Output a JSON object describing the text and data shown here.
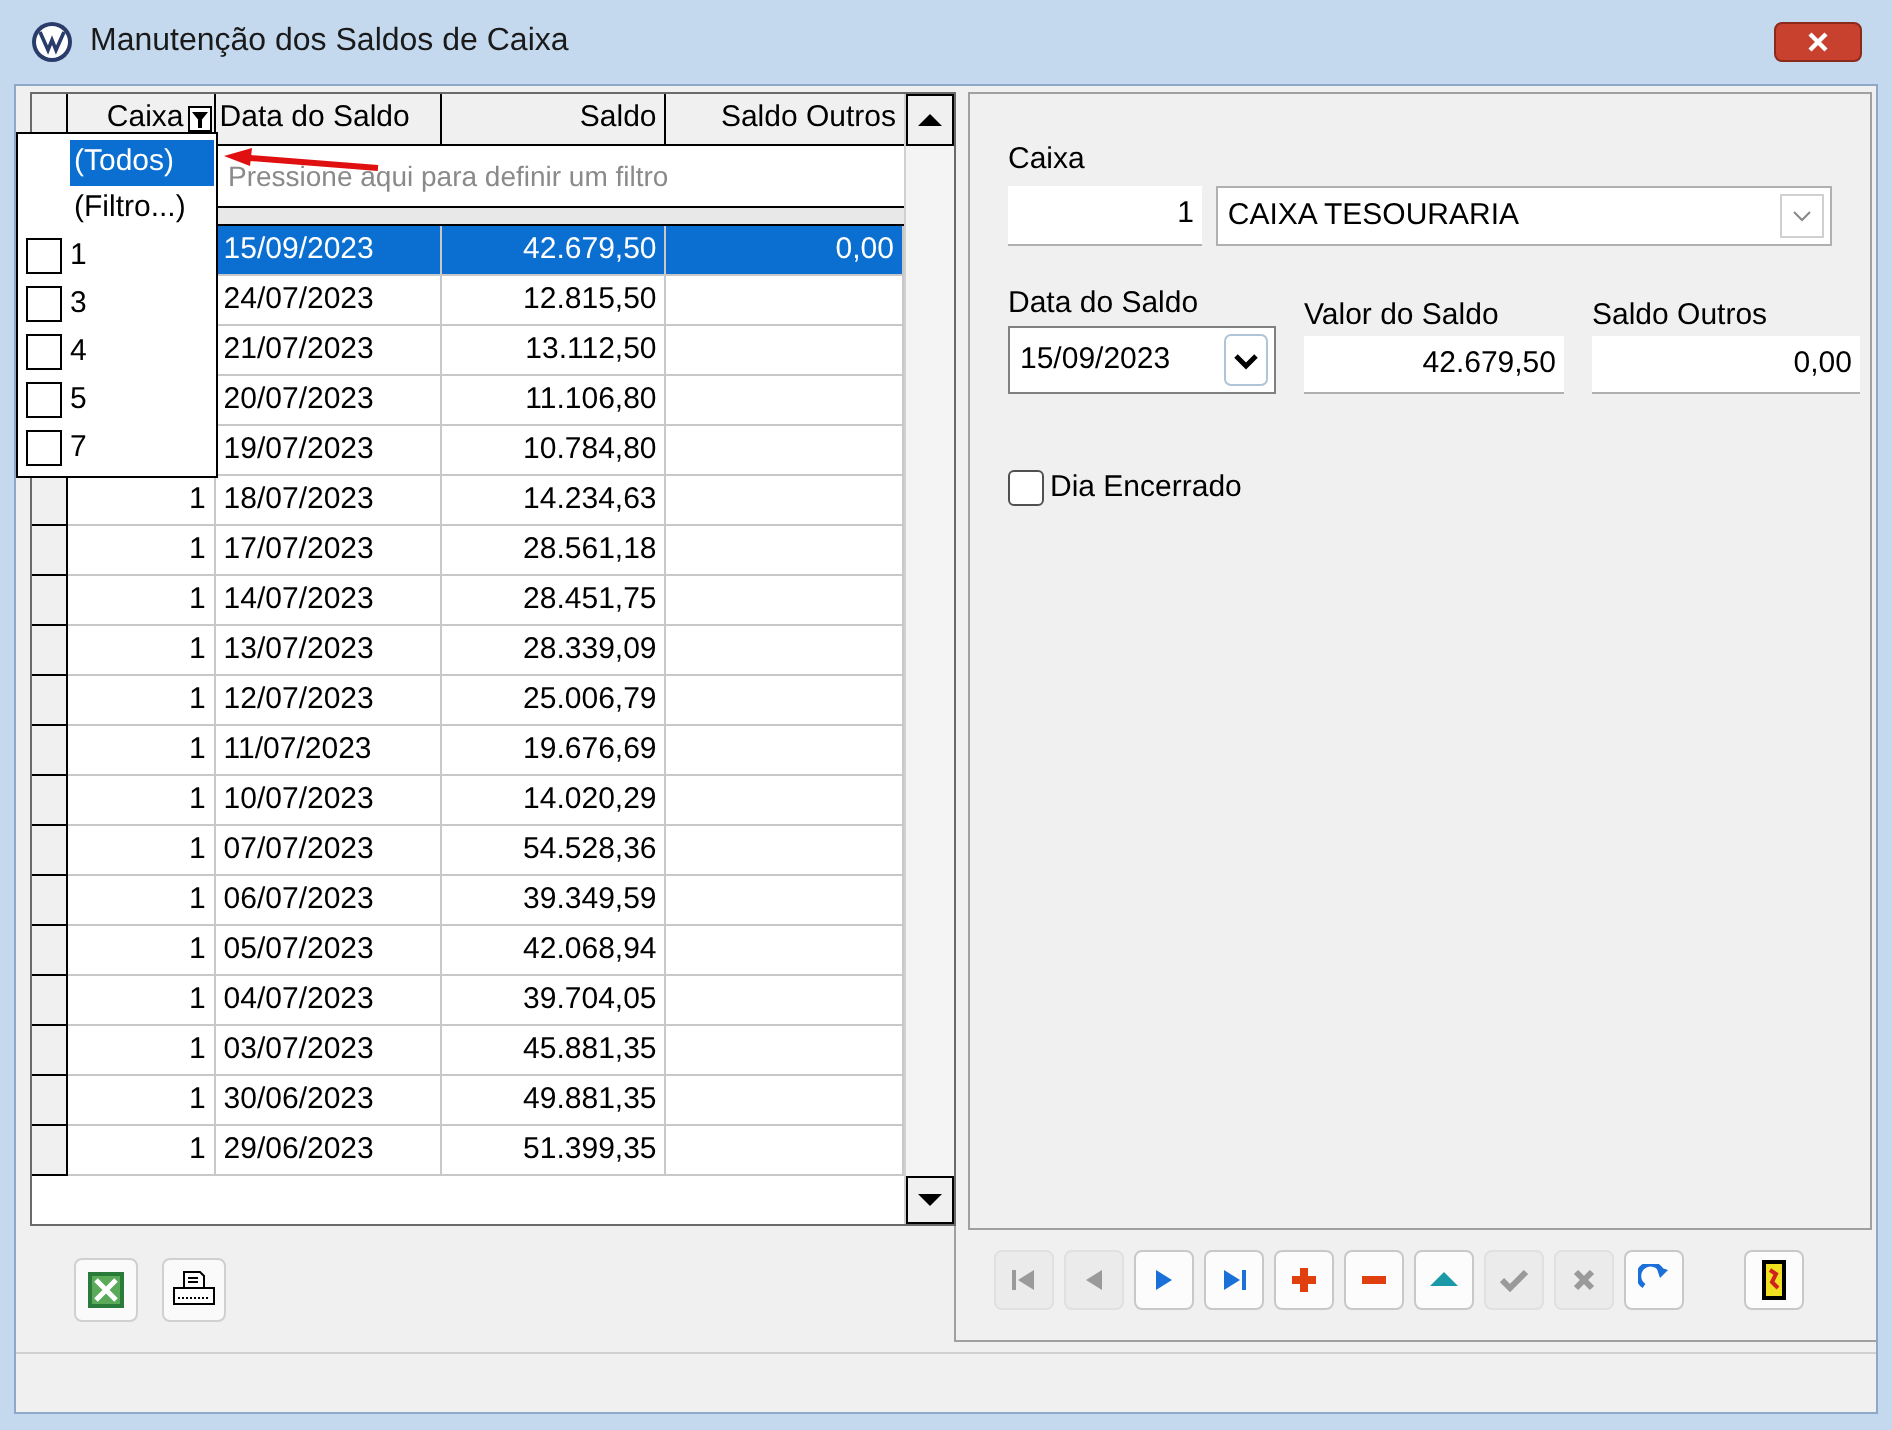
{
  "window": {
    "title": "Manutenção dos Saldos de Caixa"
  },
  "table": {
    "columns": [
      "Caixa",
      "Data do Saldo",
      "Saldo",
      "Saldo Outros"
    ],
    "filter_hint": "Pressione aqui para definir um filtro",
    "rows": [
      {
        "data": "15/09/2023",
        "saldo": "42.679,50",
        "outros": "0,00",
        "selected": true
      },
      {
        "data": "24/07/2023",
        "saldo": "12.815,50",
        "selected": false
      },
      {
        "data": "21/07/2023",
        "saldo": "13.112,50",
        "selected": false
      },
      {
        "data": "20/07/2023",
        "saldo": "11.106,80",
        "selected": false
      },
      {
        "data": "19/07/2023",
        "saldo": "10.784,80",
        "selected": false
      },
      {
        "caixa": "1",
        "data": "18/07/2023",
        "saldo": "14.234,63",
        "selected": false
      },
      {
        "caixa": "1",
        "data": "17/07/2023",
        "saldo": "28.561,18",
        "selected": false
      },
      {
        "caixa": "1",
        "data": "14/07/2023",
        "saldo": "28.451,75",
        "selected": false
      },
      {
        "caixa": "1",
        "data": "13/07/2023",
        "saldo": "28.339,09",
        "selected": false
      },
      {
        "caixa": "1",
        "data": "12/07/2023",
        "saldo": "25.006,79",
        "selected": false
      },
      {
        "caixa": "1",
        "data": "11/07/2023",
        "saldo": "19.676,69",
        "selected": false
      },
      {
        "caixa": "1",
        "data": "10/07/2023",
        "saldo": "14.020,29",
        "selected": false
      },
      {
        "caixa": "1",
        "data": "07/07/2023",
        "saldo": "54.528,36",
        "selected": false
      },
      {
        "caixa": "1",
        "data": "06/07/2023",
        "saldo": "39.349,59",
        "selected": false
      },
      {
        "caixa": "1",
        "data": "05/07/2023",
        "saldo": "42.068,94",
        "selected": false
      },
      {
        "caixa": "1",
        "data": "04/07/2023",
        "saldo": "39.704,05",
        "selected": false
      },
      {
        "caixa": "1",
        "data": "03/07/2023",
        "saldo": "45.881,35",
        "selected": false
      },
      {
        "caixa": "1",
        "data": "30/06/2023",
        "saldo": "49.881,35",
        "selected": false
      },
      {
        "caixa": "1",
        "data": "29/06/2023",
        "saldo": "51.399,35",
        "selected": false
      }
    ]
  },
  "filter_dropdown": {
    "items": [
      {
        "kind": "option",
        "label": "(Todos)",
        "selected": true
      },
      {
        "kind": "option",
        "label": "(Filtro...)",
        "selected": false
      },
      {
        "kind": "check",
        "label": "1",
        "checked": false
      },
      {
        "kind": "check",
        "label": "3",
        "checked": false
      },
      {
        "kind": "check",
        "label": "4",
        "checked": false
      },
      {
        "kind": "check",
        "label": "5",
        "checked": false
      },
      {
        "kind": "check",
        "label": "7",
        "checked": false
      }
    ]
  },
  "form": {
    "caixa_label": "Caixa",
    "caixa_code": "1",
    "caixa_name": "CAIXA TESOURARIA",
    "data_label": "Data do Saldo",
    "data_value": "15/09/2023",
    "valor_label": "Valor do Saldo",
    "valor_value": "42.679,50",
    "outros_label": "Saldo Outros",
    "outros_value": "0,00",
    "encerrado_label": "Dia Encerrado",
    "encerrado_checked": false
  },
  "navigator": [
    {
      "kind": "first",
      "disabled": true
    },
    {
      "kind": "prior",
      "disabled": true
    },
    {
      "kind": "next",
      "disabled": false
    },
    {
      "kind": "last",
      "disabled": false
    },
    {
      "kind": "insert",
      "disabled": false
    },
    {
      "kind": "delete",
      "disabled": false
    },
    {
      "kind": "edit",
      "disabled": false
    },
    {
      "kind": "post",
      "disabled": true
    },
    {
      "kind": "cancel",
      "disabled": true
    },
    {
      "kind": "refresh",
      "disabled": false
    }
  ]
}
